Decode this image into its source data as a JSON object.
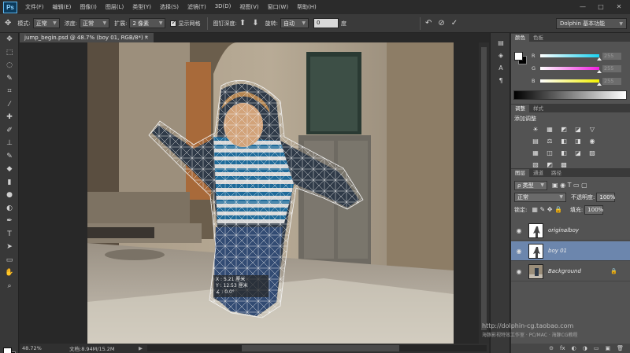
{
  "app": {
    "logo": "Ps"
  },
  "menu": [
    "文件(F)",
    "编辑(E)",
    "图像(I)",
    "图层(L)",
    "类型(Y)",
    "选择(S)",
    "滤镜(T)",
    "3D(D)",
    "视图(V)",
    "窗口(W)",
    "帮助(H)"
  ],
  "window_controls": [
    "—",
    "□",
    "✕"
  ],
  "options": {
    "mode_label": "模式:",
    "mode_value": "正常",
    "density_label": "浓度:",
    "density_value": "正常",
    "expand_label": "扩展:",
    "expand_value": "2 像素",
    "show_mesh_label": "显示网格",
    "pin_depth_label": "图钉深度:",
    "rotate_label": "旋转:",
    "rotate_value": "自动",
    "rotate_angle": "0",
    "degree_unit": "度",
    "workspace": "Dolphin 基本功能"
  },
  "document": {
    "tab_title": "jump_begin.psd @ 48.7% (boy 01, RGB/8*) *",
    "close": "×"
  },
  "transform_readout": {
    "x": "X :   5.21 厘米",
    "y": "Y :  12.53 厘米",
    "angle": "∡ :        0.0°"
  },
  "status": {
    "zoom": "48.72%",
    "doc_info": "文档:8.94M/15.2M",
    "arrow": "▶"
  },
  "color_panel": {
    "tabs": [
      "颜色",
      "色板"
    ],
    "channels": [
      {
        "label": "R",
        "value": "255",
        "knob_fraction": 1.0
      },
      {
        "label": "G",
        "value": "255",
        "knob_fraction": 1.0
      },
      {
        "label": "B",
        "value": "255",
        "knob_fraction": 1.0
      }
    ],
    "channel_colors": [
      "#19d1f0",
      "#f01ee0",
      "#f2f000"
    ]
  },
  "adjustments_panel": {
    "tabs": [
      "调整",
      "样式"
    ],
    "title": "添加调整",
    "icons": [
      "☀",
      "▦",
      "◩",
      "◪",
      "▽",
      "▤",
      "⚖",
      "◧",
      "◨",
      "◉",
      "▦",
      "◫",
      "◧",
      "◪",
      "▨",
      "▧",
      "◩",
      "▩"
    ]
  },
  "layers_panel": {
    "tabs": [
      "图层",
      "通道",
      "路径"
    ],
    "filter_label": "ρ 类型",
    "blend_mode": "正常",
    "opacity_label": "不透明度:",
    "opacity_value": "100%",
    "lock_label": "锁定:",
    "fill_label": "填充:",
    "fill_value": "100%",
    "layers": [
      {
        "name": "originalboy",
        "selected": false,
        "locked": false
      },
      {
        "name": "boy 01",
        "selected": true,
        "locked": false
      },
      {
        "name": "Background",
        "selected": false,
        "locked": true
      }
    ],
    "footer_icons": [
      "⊝",
      "fx",
      "◐",
      "◑",
      "▭",
      "▣",
      "🗑"
    ]
  },
  "watermark": {
    "line1": "http://dolphin-cg.taobao.com",
    "line2": "海豚影视特效工作室 · PC/MAC · 海豚CG教程"
  }
}
